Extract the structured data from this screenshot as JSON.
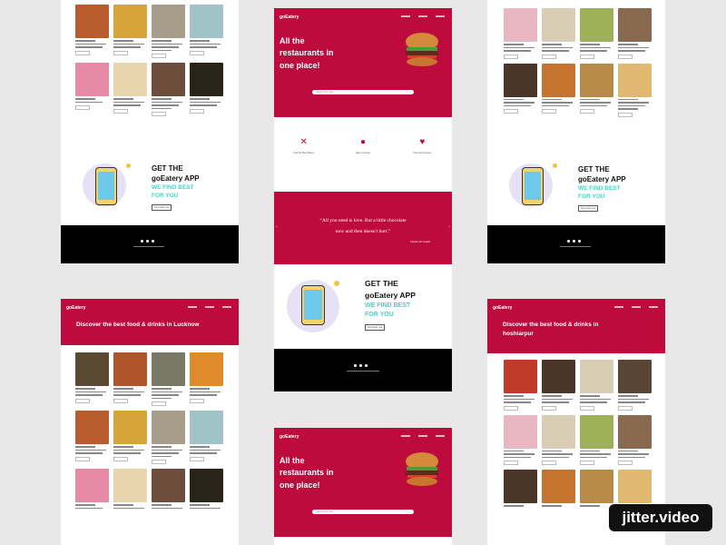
{
  "brand": {
    "logo": "goEatery",
    "accent": "#be0b3e",
    "cyan": "#3ed6c7"
  },
  "hero": {
    "headline_1": "All the",
    "headline_2": "restaurants in",
    "headline_3": "one place!",
    "search_placeholder": "Search for city"
  },
  "features": [
    {
      "icon": "utensils-icon",
      "label": "Find the Best Places"
    },
    {
      "icon": "map-pin-icon",
      "label": "Easy to locate"
    },
    {
      "icon": "heart-icon",
      "label": "Pure food recipes"
    }
  ],
  "quote": {
    "line_1": "“All you need is love. But a little chocolate",
    "line_2": "now and then doesn't hurt.”",
    "author": "Charles M. Schulz"
  },
  "app": {
    "title_1": "GET THE",
    "title_2": "goEatery APP",
    "sub_1": "WE FIND BEST",
    "sub_2": "FOR YOU",
    "button": "Download now"
  },
  "city_pages": [
    {
      "heading": "Discover the best food & drinks in Lucknow"
    },
    {
      "heading_1": "Discover the best food & drinks in",
      "heading_2": "hoshiarpur"
    }
  ],
  "watermark": "jitter.video"
}
